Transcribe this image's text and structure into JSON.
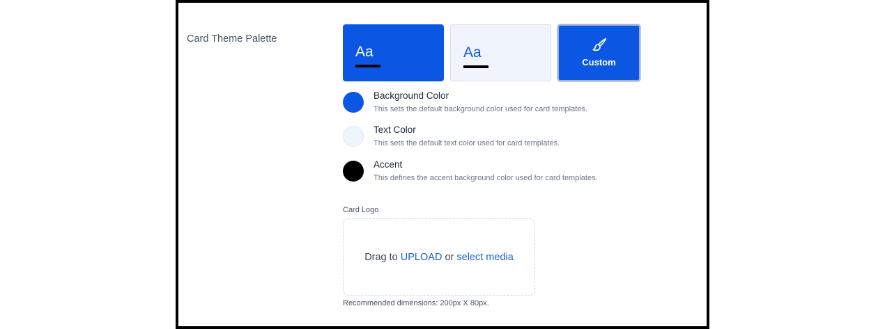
{
  "section": {
    "label": "Card Theme Palette"
  },
  "themes": [
    {
      "sample": "Aa",
      "background": "#0b57e3",
      "text_color": "#ffffff",
      "accent": "#000000"
    },
    {
      "sample": "Aa",
      "background": "#eff4fd",
      "text_color": "#0b57e3",
      "accent": "#000000"
    },
    {
      "label": "Custom",
      "icon": "paintbrush-icon",
      "background": "#0b57e3",
      "selected": true
    }
  ],
  "colors": [
    {
      "title": "Background Color",
      "description": "This sets the default background color used for card templates.",
      "value": "#0b57e3"
    },
    {
      "title": "Text Color",
      "description": "This sets the default text color used for card templates.",
      "value": "#eff4fd"
    },
    {
      "title": "Accent",
      "description": "This defines the accent background color used for card templates.",
      "value": "#000000"
    }
  ],
  "logo": {
    "label": "Card Logo",
    "drop_prefix": "Drag to",
    "upload_link": "UPLOAD",
    "or_text": "or",
    "select_link": "select media",
    "hint": "Recommended dimensions: 200px X 80px."
  }
}
